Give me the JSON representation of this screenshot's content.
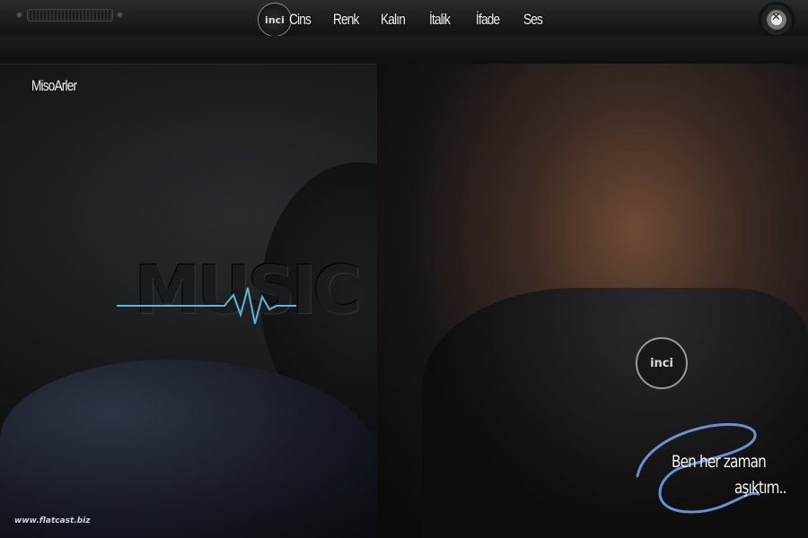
{
  "topbar": {
    "logo_text": "inci",
    "menu": [
      "Cins",
      "Renk",
      "Kalın",
      "İtalik",
      "İfade",
      "Ses"
    ]
  },
  "subbar": {
    "label": "MisoArler"
  },
  "scene": {
    "watermark": "MUSIC",
    "badge_text": "inci",
    "quote_line1": "Ben her zaman",
    "quote_line2": "aşıktım.."
  },
  "credit": "www.flatcast.biz",
  "colors": {
    "pulse": "#5fb7d6",
    "signature": "#6d8fd0"
  },
  "icons": {
    "settings": "gear-icon",
    "volume": "slider-track"
  }
}
